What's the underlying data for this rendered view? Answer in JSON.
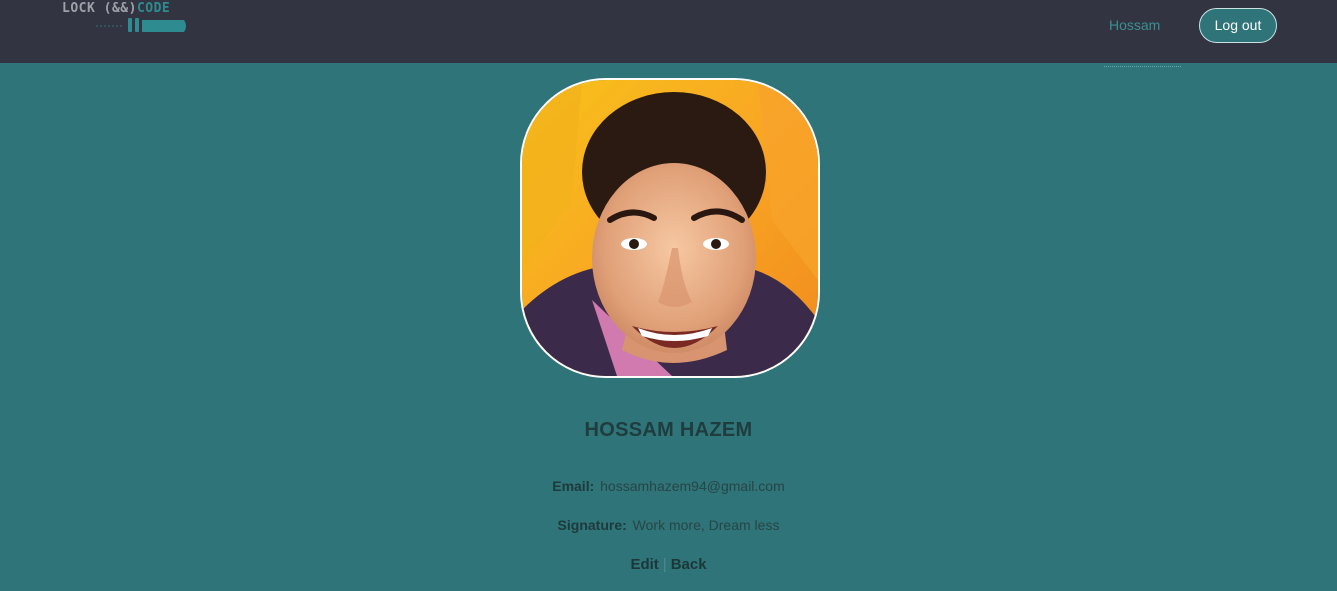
{
  "nav": {
    "logo": {
      "lock_text": "LOCK (&&)",
      "code_text": "CODE"
    },
    "user_link": "Hossam",
    "logout_label": "Log out"
  },
  "profile": {
    "name": "HOSSAM HAZEM",
    "email_label": "Email:",
    "email": "hossamhazem94@gmail.com",
    "signature_label": "Signature:",
    "signature": "Work more, Dream less"
  },
  "actions": {
    "edit": "Edit",
    "separator": "|",
    "back": "Back"
  },
  "colors": {
    "navbar": "#333441",
    "background": "#2e7478",
    "accent": "#3a8f93"
  }
}
